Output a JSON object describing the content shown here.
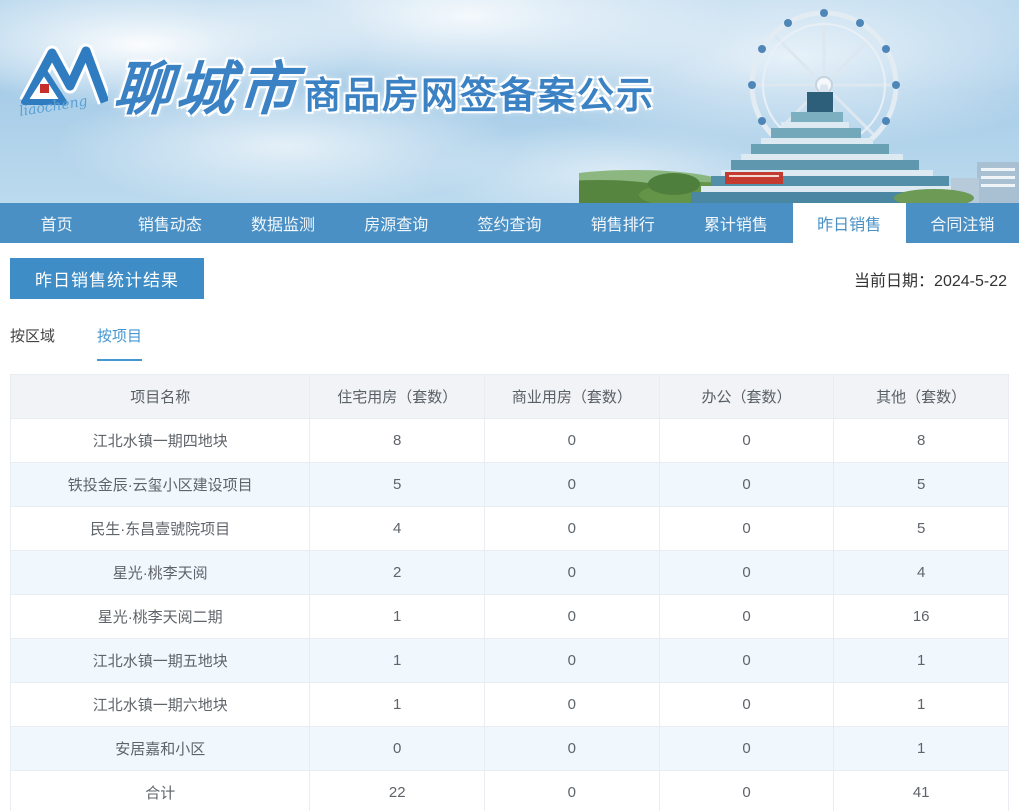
{
  "brand": {
    "logo_text": "liaocheng",
    "city_name": "聊城市",
    "site_title": "商品房网签备案公示"
  },
  "nav": {
    "items": [
      {
        "label": "首页",
        "active": false
      },
      {
        "label": "销售动态",
        "active": false
      },
      {
        "label": "数据监测",
        "active": false
      },
      {
        "label": "房源查询",
        "active": false
      },
      {
        "label": "签约查询",
        "active": false
      },
      {
        "label": "销售排行",
        "active": false
      },
      {
        "label": "累计销售",
        "active": false
      },
      {
        "label": "昨日销售",
        "active": true
      },
      {
        "label": "合同注销",
        "active": false
      }
    ]
  },
  "page": {
    "title": "昨日销售统计结果",
    "date_label": "当前日期：",
    "date_value": "2024-5-22"
  },
  "filter_tabs": [
    {
      "label": "按区域",
      "active": false
    },
    {
      "label": "按项目",
      "active": true
    }
  ],
  "table": {
    "columns": [
      "项目名称",
      "住宅用房（套数）",
      "商业用房（套数）",
      "办公（套数）",
      "其他（套数）"
    ],
    "rows": [
      {
        "name": "江北水镇一期四地块",
        "residential": "8",
        "commercial": "0",
        "office": "0",
        "other": "8"
      },
      {
        "name": "铁投金辰·云玺小区建设项目",
        "residential": "5",
        "commercial": "0",
        "office": "0",
        "other": "5"
      },
      {
        "name": "民生·东昌壹號院项目",
        "residential": "4",
        "commercial": "0",
        "office": "0",
        "other": "5"
      },
      {
        "name": "星光·桃李天阅",
        "residential": "2",
        "commercial": "0",
        "office": "0",
        "other": "4"
      },
      {
        "name": "星光·桃李天阅二期",
        "residential": "1",
        "commercial": "0",
        "office": "0",
        "other": "16"
      },
      {
        "name": "江北水镇一期五地块",
        "residential": "1",
        "commercial": "0",
        "office": "0",
        "other": "1"
      },
      {
        "name": "江北水镇一期六地块",
        "residential": "1",
        "commercial": "0",
        "office": "0",
        "other": "1"
      },
      {
        "name": "安居嘉和小区",
        "residential": "0",
        "commercial": "0",
        "office": "0",
        "other": "1"
      },
      {
        "name": "合计",
        "residential": "22",
        "commercial": "0",
        "office": "0",
        "other": "41"
      }
    ]
  },
  "colors": {
    "nav_blue": "#4a90c5",
    "title_blue": "#3e8dc6",
    "accent_blue": "#4597d3",
    "brand_blue": "#3b82c4",
    "row_alt_bg": "#f0f7fd",
    "table_header_bg": "#f1f3f7",
    "logo_red": "#c62f2a"
  }
}
